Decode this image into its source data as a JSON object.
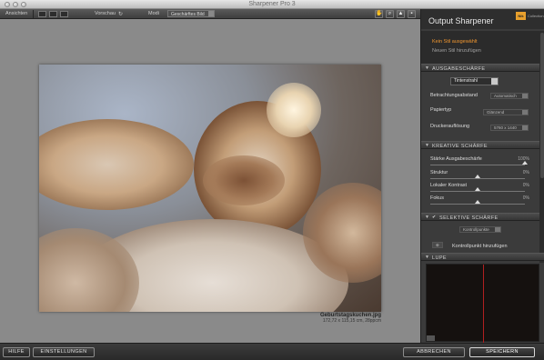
{
  "window": {
    "title": "Sharpener Pro 3"
  },
  "toolbar": {
    "view_label": "Ansichten",
    "preview_label": "Vorschau",
    "mode_label": "Modi",
    "mode_value": "Geschärftes Bild"
  },
  "image": {
    "filename": "Geburtstagskuchen.jpg",
    "dimensions": "172,72 x 115,15 cm, 28ppcm"
  },
  "panel": {
    "title": "Output Sharpener",
    "logo_text": "Nik",
    "logo_sub": "Collection",
    "presets": {
      "none_selected": "Kein Stil ausgewählt",
      "add_new": "Neuen Stil hinzufügen"
    },
    "output_section": {
      "header": "AUSGABESCHÄRFE",
      "output_type": "Tintenstrahl",
      "rows": [
        {
          "label": "Betrachtungsabstand",
          "value": "Automatisch"
        },
        {
          "label": "Papiertyp",
          "value": "Glänzend"
        },
        {
          "label": "Druckerauflösung",
          "value": "5760 x 1440"
        }
      ]
    },
    "creative_section": {
      "header": "KREATIVE SCHÄRFE",
      "sliders": [
        {
          "label": "Stärke Ausgabeschärfe",
          "value": "100%",
          "level": 1.0
        },
        {
          "label": "Struktur",
          "value": "0%",
          "level": 0.5
        },
        {
          "label": "Lokaler Kontrast",
          "value": "0%",
          "level": 0.5
        },
        {
          "label": "Fokus",
          "value": "0%",
          "level": 0.5
        }
      ]
    },
    "selective_section": {
      "header": "SELEKTIVE SCHÄRFE",
      "control_points_label": "Kontrollpunkte",
      "add_control_point": "Kontrollpunkt hinzufügen"
    },
    "loupe_section": {
      "header": "LUPE"
    }
  },
  "bottom": {
    "help": "HILFE",
    "settings": "EINSTELLUNGEN",
    "cancel": "ABBRECHEN",
    "save": "SPEICHERN"
  },
  "colors": {
    "accent": "#f0962f",
    "loupe_line": "#b01f1f"
  }
}
